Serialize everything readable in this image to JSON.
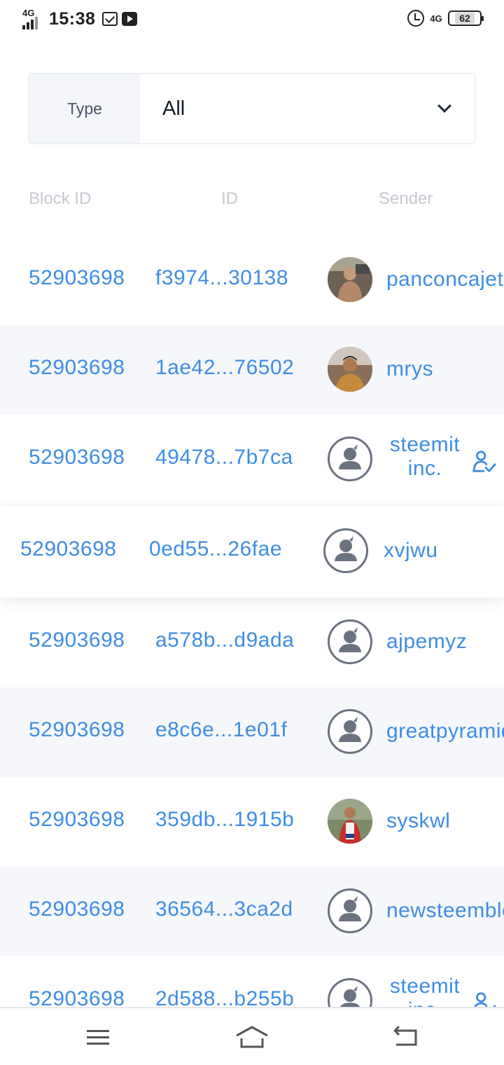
{
  "status_bar": {
    "network_left": "4G",
    "time": "15:38",
    "network_right": "4G",
    "battery": "62"
  },
  "filter": {
    "label": "Type",
    "value": "All"
  },
  "table": {
    "columns": [
      "Block ID",
      "ID",
      "Sender"
    ],
    "rows": [
      {
        "block_id": "52903698",
        "id": "f3974...30138",
        "sender": "panconcajeta",
        "avatar": "photo",
        "verified": false
      },
      {
        "block_id": "52903698",
        "id": "1ae42...76502",
        "sender": "mrys",
        "avatar": "photo",
        "verified": false
      },
      {
        "block_id": "52903698",
        "id": "49478...7b7ca",
        "sender": "steemit inc.",
        "avatar": "default",
        "verified": true
      },
      {
        "block_id": "52903698",
        "id": "0ed55...26fae",
        "sender": "xvjwu",
        "avatar": "default",
        "verified": false
      },
      {
        "block_id": "52903698",
        "id": "a578b...d9ada",
        "sender": "ajpemyz",
        "avatar": "default",
        "verified": false
      },
      {
        "block_id": "52903698",
        "id": "e8c6e...1e01f",
        "sender": "greatpyramid",
        "avatar": "default",
        "verified": false
      },
      {
        "block_id": "52903698",
        "id": "359db...1915b",
        "sender": "syskwl",
        "avatar": "photo",
        "verified": false
      },
      {
        "block_id": "52903698",
        "id": "36564...3ca2d",
        "sender": "newsteemblog",
        "avatar": "default",
        "verified": false
      },
      {
        "block_id": "52903698",
        "id": "2d588...b255b",
        "sender": "steemit inc.",
        "avatar": "default",
        "verified": true
      }
    ]
  },
  "bottom_nav": {
    "icons": [
      "menu-icon",
      "home-icon",
      "back-icon"
    ]
  },
  "colors": {
    "link": "#3d8de4",
    "header_text": "#c4c9d0",
    "alt_row": "#f5f7fb"
  }
}
